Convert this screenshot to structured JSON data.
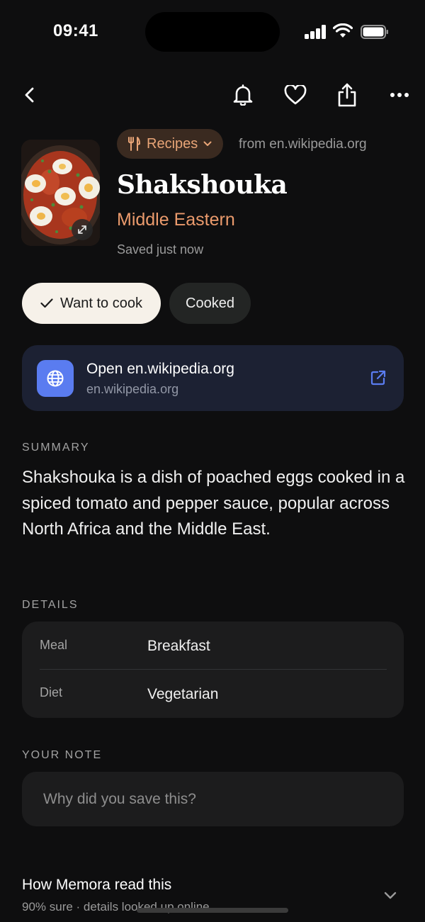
{
  "status_bar": {
    "time": "09:41"
  },
  "item": {
    "category": "Recipes",
    "source_from": "from en.wikipedia.org",
    "title": "Shakshouka",
    "cuisine": "Middle Eastern",
    "saved": "Saved just now"
  },
  "actions": {
    "want_to_cook": "Want to cook",
    "cooked": "Cooked"
  },
  "link": {
    "title": "Open en.wikipedia.org",
    "domain": "en.wikipedia.org"
  },
  "summary": {
    "label": "SUMMARY",
    "text": "Shakshouka is a dish of poached eggs cooked in a spiced tomato and pepper sauce, popular across North Africa and the Middle East."
  },
  "details": {
    "label": "DETAILS",
    "rows": [
      {
        "key": "Meal",
        "value": "Breakfast"
      },
      {
        "key": "Diet",
        "value": "Vegetarian"
      }
    ]
  },
  "note": {
    "label": "YOUR NOTE",
    "placeholder": "Why did you save this?",
    "value": ""
  },
  "how_read": {
    "title": "How Memora read this",
    "subtitle": "90% sure · details looked up online"
  },
  "colors": {
    "accent_orange": "#ea9a6c",
    "link_blue": "#5a7cf0",
    "background": "#0e0e0f"
  },
  "icons": [
    "back-icon",
    "bell-icon",
    "heart-icon",
    "share-icon",
    "more-icon",
    "fork-knife-icon",
    "chevron-down-icon",
    "expand-icon",
    "check-icon",
    "globe-icon",
    "external-link-icon"
  ]
}
